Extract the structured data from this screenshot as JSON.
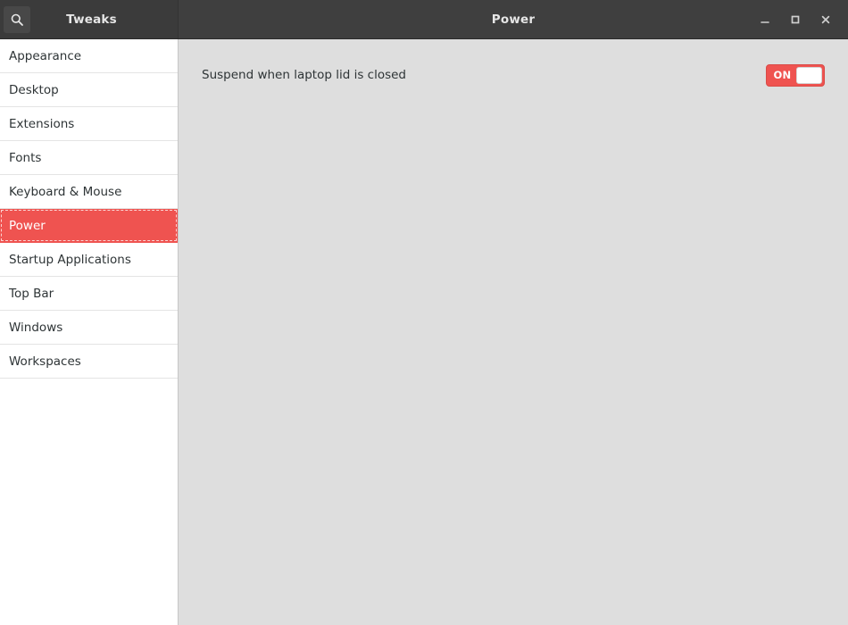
{
  "header": {
    "app_title": "Tweaks",
    "page_title": "Power",
    "search_icon": "search-icon",
    "controls": {
      "minimize": "minimize-icon",
      "maximize": "maximize-icon",
      "close": "close-icon"
    }
  },
  "sidebar": {
    "items": [
      {
        "label": "Appearance",
        "selected": false
      },
      {
        "label": "Desktop",
        "selected": false
      },
      {
        "label": "Extensions",
        "selected": false
      },
      {
        "label": "Fonts",
        "selected": false
      },
      {
        "label": "Keyboard & Mouse",
        "selected": false
      },
      {
        "label": "Power",
        "selected": true
      },
      {
        "label": "Startup Applications",
        "selected": false
      },
      {
        "label": "Top Bar",
        "selected": false
      },
      {
        "label": "Windows",
        "selected": false
      },
      {
        "label": "Workspaces",
        "selected": false
      }
    ]
  },
  "content": {
    "settings": [
      {
        "label": "Suspend when laptop lid is closed",
        "toggle_state": "ON"
      }
    ]
  },
  "colors": {
    "accent": "#ef5350",
    "headerbar": "#3c3c3c",
    "content_bg": "#dedede",
    "sidebar_bg": "#ffffff"
  }
}
